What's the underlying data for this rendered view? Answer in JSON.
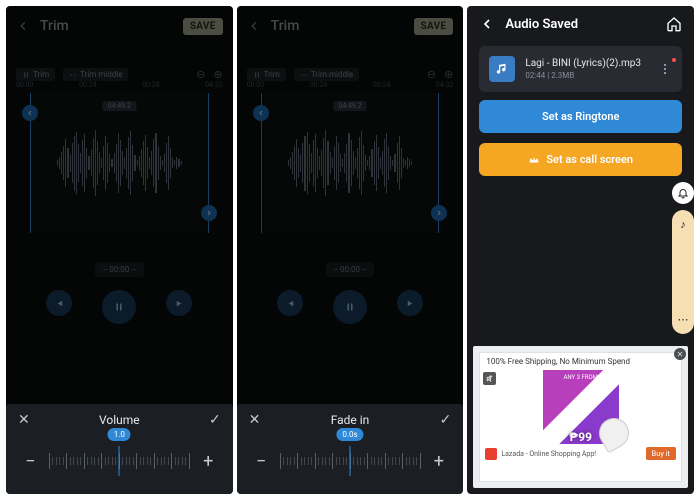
{
  "panel1": {
    "header": {
      "title": "Trim",
      "save_label": "SAVE"
    },
    "chips": {
      "trim": "Trim",
      "trim_middle": "Trim middle"
    },
    "ticks": {
      "t0": "00:00",
      "t1": "00:24",
      "t2": "00:24",
      "t3": "04:32"
    },
    "tag": "04:49.2",
    "time_pill": "-- 00:00 --",
    "sheet": {
      "title": "Volume",
      "value": "1.0"
    }
  },
  "panel2": {
    "header": {
      "title": "Trim",
      "save_label": "SAVE"
    },
    "chips": {
      "trim": "Trim",
      "trim_middle": "Trim middle"
    },
    "ticks": {
      "t0": "00:00",
      "t1": "00:24",
      "t2": "00:24",
      "t3": "04:32"
    },
    "tag": "04:49.2",
    "time_pill": "-- 00:00 --",
    "sheet": {
      "title": "Fade in",
      "value": "0.0s"
    }
  },
  "panel3": {
    "header_title": "Audio Saved",
    "file": {
      "name": "Lagi - BINI (Lyrics)(2).mp3",
      "meta": "02:44 | 2.3MB"
    },
    "btn_ringtone": "Set as Ringtone",
    "btn_callscreen": "Set as call screen",
    "ad": {
      "headline": "100% Free Shipping, No Minimum Spend",
      "price_prefix": "ANY 3 FROM",
      "price": "₱99",
      "store": "Lazada - Online Shopping App!",
      "cta": "Buy it"
    }
  }
}
